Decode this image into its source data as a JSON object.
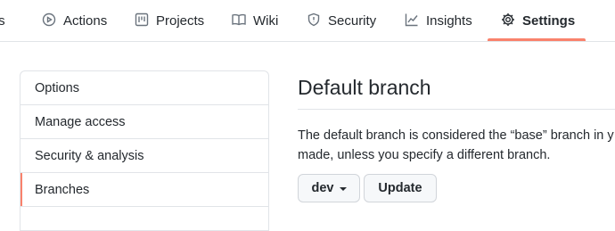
{
  "nav": {
    "tabs": [
      {
        "label": "ts",
        "icon": "none"
      },
      {
        "label": "Actions",
        "icon": "play-icon"
      },
      {
        "label": "Projects",
        "icon": "project-icon"
      },
      {
        "label": "Wiki",
        "icon": "book-icon"
      },
      {
        "label": "Security",
        "icon": "shield-icon"
      },
      {
        "label": "Insights",
        "icon": "graph-icon"
      },
      {
        "label": "Settings",
        "icon": "gear-icon",
        "selected": true
      }
    ],
    "accent_color": "#f9826c"
  },
  "sidebar": {
    "items": [
      {
        "label": "Options"
      },
      {
        "label": "Manage access"
      },
      {
        "label": "Security & analysis"
      },
      {
        "label": "Branches",
        "selected": true
      }
    ]
  },
  "main": {
    "title": "Default branch",
    "description_line1": "The default branch is considered the “base” branch in y",
    "description_line2": "made, unless you specify a different branch.",
    "branch_select_value": "dev",
    "update_button_label": "Update"
  }
}
